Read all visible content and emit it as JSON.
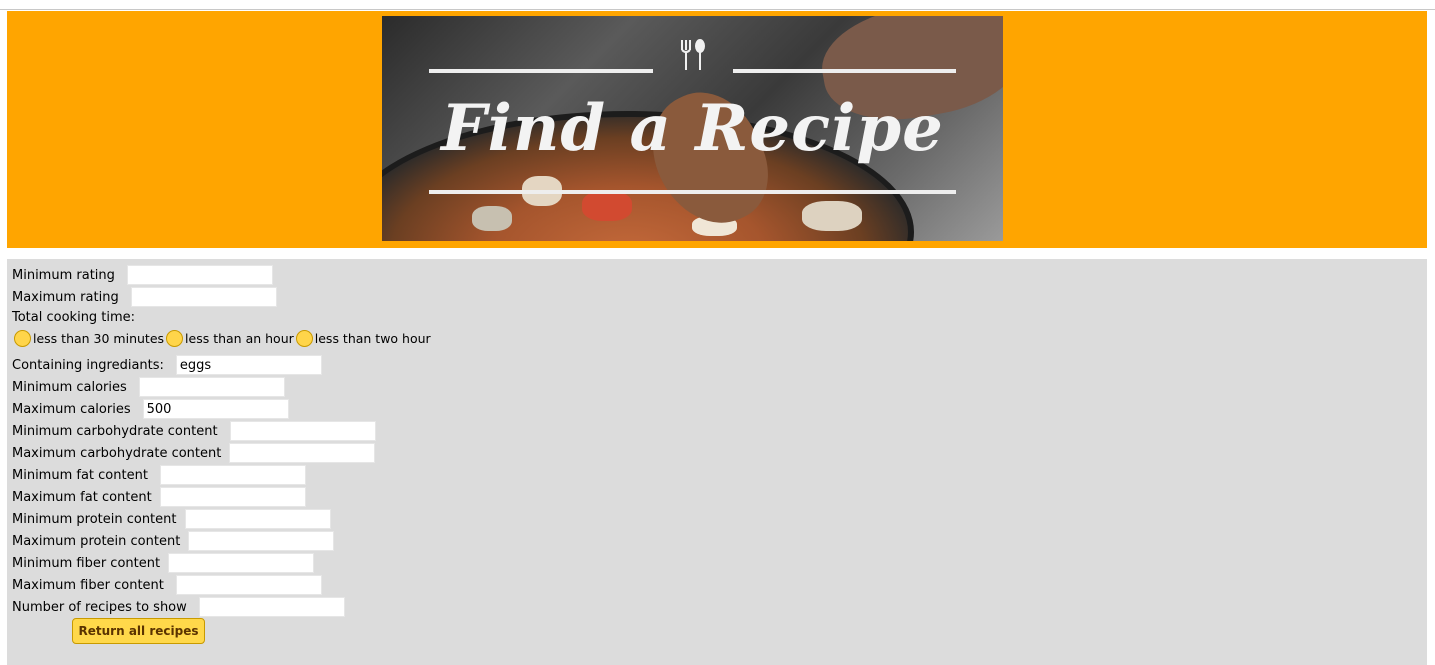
{
  "header": {
    "banner_title": "Find a Recipe",
    "utensils_icon": "fork-spoon-icon"
  },
  "form": {
    "fields": [
      {
        "label": "Minimum rating",
        "value": "",
        "placeholder": ""
      },
      {
        "label": "Maximum rating",
        "value": "",
        "placeholder": ""
      }
    ],
    "cooking_time_label": "Total cooking time:",
    "cooking_time_options": [
      "less than 30 minutes",
      "less than an hour",
      "less than two hour"
    ],
    "ingredients_label": "Containing ingrediants:",
    "ingredients_value": "eggs",
    "nutrition_fields": [
      {
        "label": "Minimum calories",
        "value": ""
      },
      {
        "label": "Maximum calories",
        "value": "500"
      },
      {
        "label": "Minimum carbohydrate content",
        "value": ""
      },
      {
        "label": "Maximum carbohydrate content",
        "value": ""
      },
      {
        "label": "Minimum fat content",
        "value": ""
      },
      {
        "label": "Maximum fat content",
        "value": ""
      },
      {
        "label": "Minimum protein content",
        "value": ""
      },
      {
        "label": "Maximum protein content",
        "value": ""
      },
      {
        "label": "Minimum fiber content",
        "value": ""
      },
      {
        "label": "Maximum fiber content",
        "value": ""
      },
      {
        "label": "Number of recipes to show",
        "value": ""
      }
    ],
    "submit_label": "Return all recipes"
  },
  "colors": {
    "header_bg": "#ffa500",
    "form_bg": "#dcdcdc",
    "button_bg": "#ffd84a",
    "radio_fill": "#ffd54a"
  }
}
